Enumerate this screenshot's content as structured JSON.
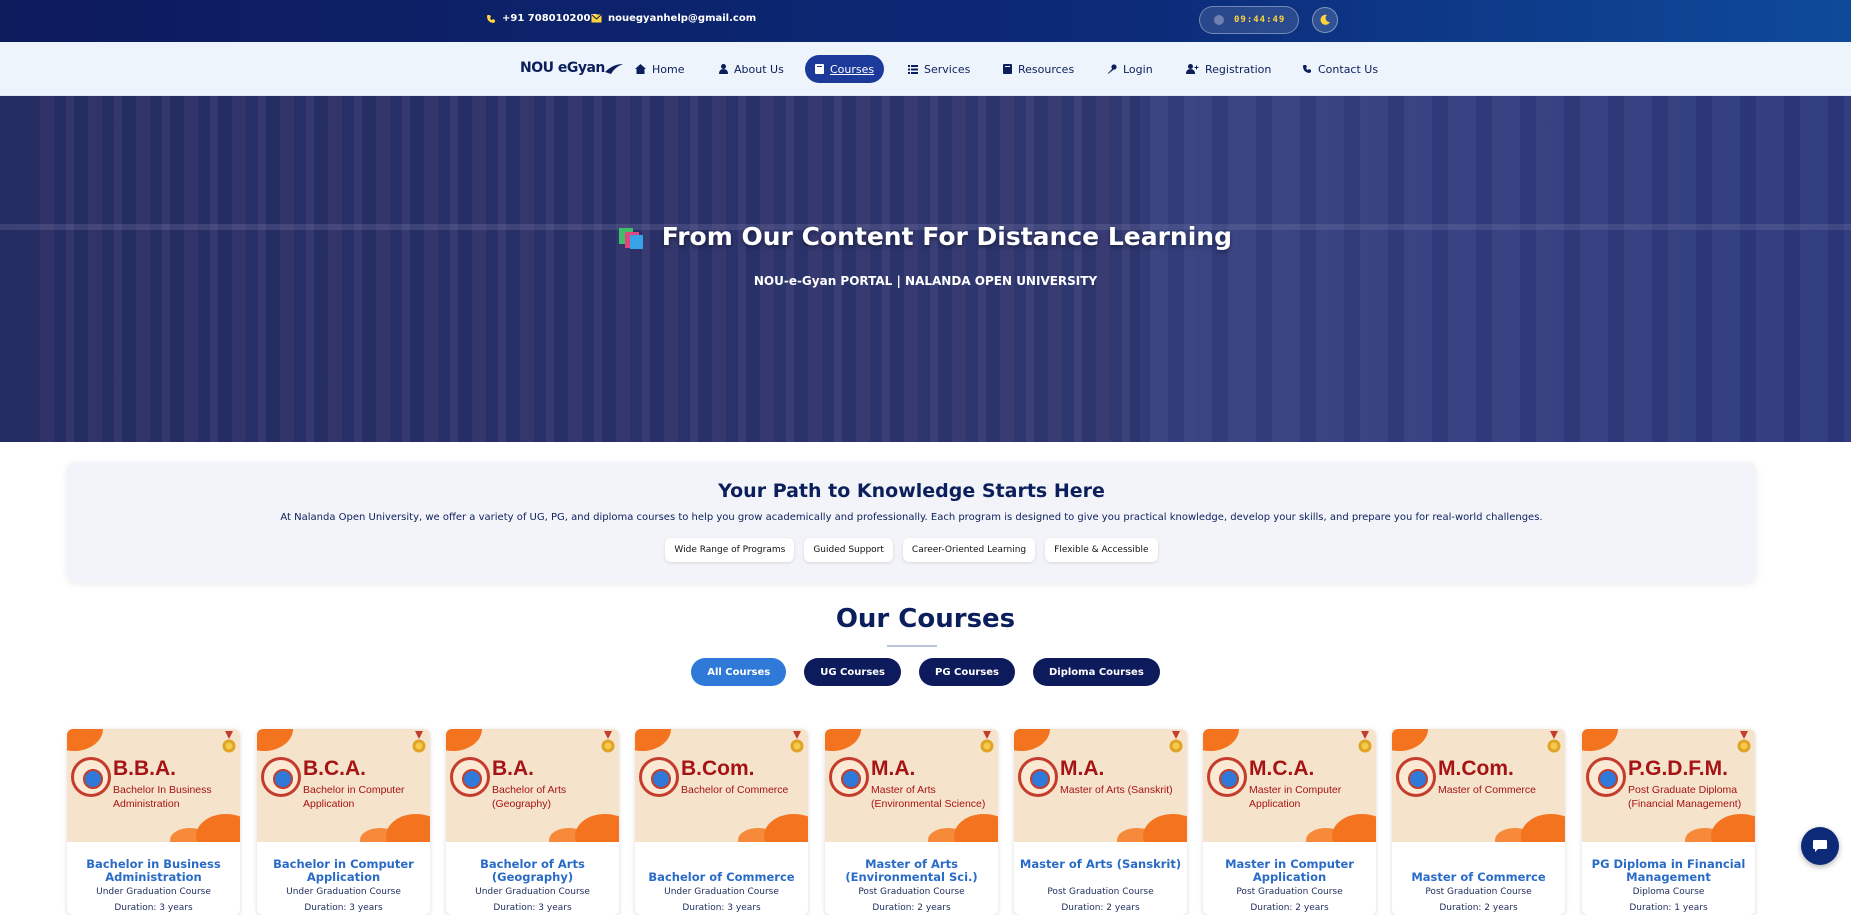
{
  "topbar": {
    "phone": "+91 7080102007",
    "email": "nouegyanhelp@gmail.com",
    "clock": "09:44:49",
    "theme_icon": "moon-icon"
  },
  "nav": {
    "logo": "NOU eGyan",
    "items": [
      {
        "label": "Home",
        "icon": "home-icon"
      },
      {
        "label": "About Us",
        "icon": "user-icon"
      },
      {
        "label": "Courses",
        "icon": "book-icon",
        "active": true
      },
      {
        "label": "Services",
        "icon": "list-icon"
      },
      {
        "label": "Resources",
        "icon": "book-icon"
      },
      {
        "label": "Login",
        "icon": "key-icon"
      },
      {
        "label": "Registration",
        "icon": "user-plus-icon"
      },
      {
        "label": "Contact Us",
        "icon": "phone-icon"
      }
    ]
  },
  "hero": {
    "title": "From Our Content For Distance Learning",
    "subtitle": "NOU-e-Gyan PORTAL | NALANDA OPEN UNIVERSITY"
  },
  "intro": {
    "heading": "Your Path to Knowledge Starts Here",
    "text": "At Nalanda Open University, we offer a variety of UG, PG, and diploma courses to help you grow academically and professionally. Each program is designed to give you practical knowledge, develop your skills, and prepare you for real-world challenges.",
    "chips": [
      "Wide Range of Programs",
      "Guided Support",
      "Career-Oriented Learning",
      "Flexible & Accessible"
    ]
  },
  "courses": {
    "heading": "Our Courses",
    "filters": [
      "All Courses",
      "UG Courses",
      "PG Courses",
      "Diploma Courses"
    ],
    "active_filter": "All Courses",
    "cards": [
      {
        "abbr": "B.B.A.",
        "full": "Bachelor In Business Administration",
        "name": "Bachelor in Business Administration",
        "type": "Under Graduation Course",
        "duration": "Duration: 3 years"
      },
      {
        "abbr": "B.C.A.",
        "full": "Bachelor in Computer Application",
        "name": "Bachelor in Computer Application",
        "type": "Under Graduation Course",
        "duration": "Duration: 3 years"
      },
      {
        "abbr": "B.A.",
        "full": "Bachelor of Arts (Geography)",
        "name": "Bachelor of Arts (Geography)",
        "type": "Under Graduation Course",
        "duration": "Duration: 3 years"
      },
      {
        "abbr": "B.Com.",
        "full": "Bachelor of Commerce",
        "name": "Bachelor of Commerce",
        "type": "Under Graduation Course",
        "duration": "Duration: 3 years"
      },
      {
        "abbr": "M.A.",
        "full": "Master of Arts (Environmental Science)",
        "name": "Master of Arts (Environmental Sci.)",
        "type": "Post Graduation Course",
        "duration": "Duration: 2 years"
      },
      {
        "abbr": "M.A.",
        "full": "Master of Arts (Sanskrit)",
        "name": "Master of Arts (Sanskrit)",
        "type": "Post Graduation Course",
        "duration": "Duration: 2 years"
      },
      {
        "abbr": "M.C.A.",
        "full": "Master in Computer Application",
        "name": "Master in Computer Application",
        "type": "Post Graduation Course",
        "duration": "Duration: 2 years"
      },
      {
        "abbr": "M.Com.",
        "full": "Master of Commerce",
        "name": "Master of Commerce",
        "type": "Post Graduation Course",
        "duration": "Duration: 2 years"
      },
      {
        "abbr": "P.G.D.F.M.",
        "full": "Post Graduate Diploma (Financial Management)",
        "name": "PG Diploma in Financial Management",
        "type": "Diploma Course",
        "duration": "Duration: 1 years"
      }
    ]
  },
  "colors": {
    "navy": "#0d1a5c",
    "accent_blue": "#2f7ad8",
    "orange": "#f4731f",
    "maroon": "#a51414"
  }
}
